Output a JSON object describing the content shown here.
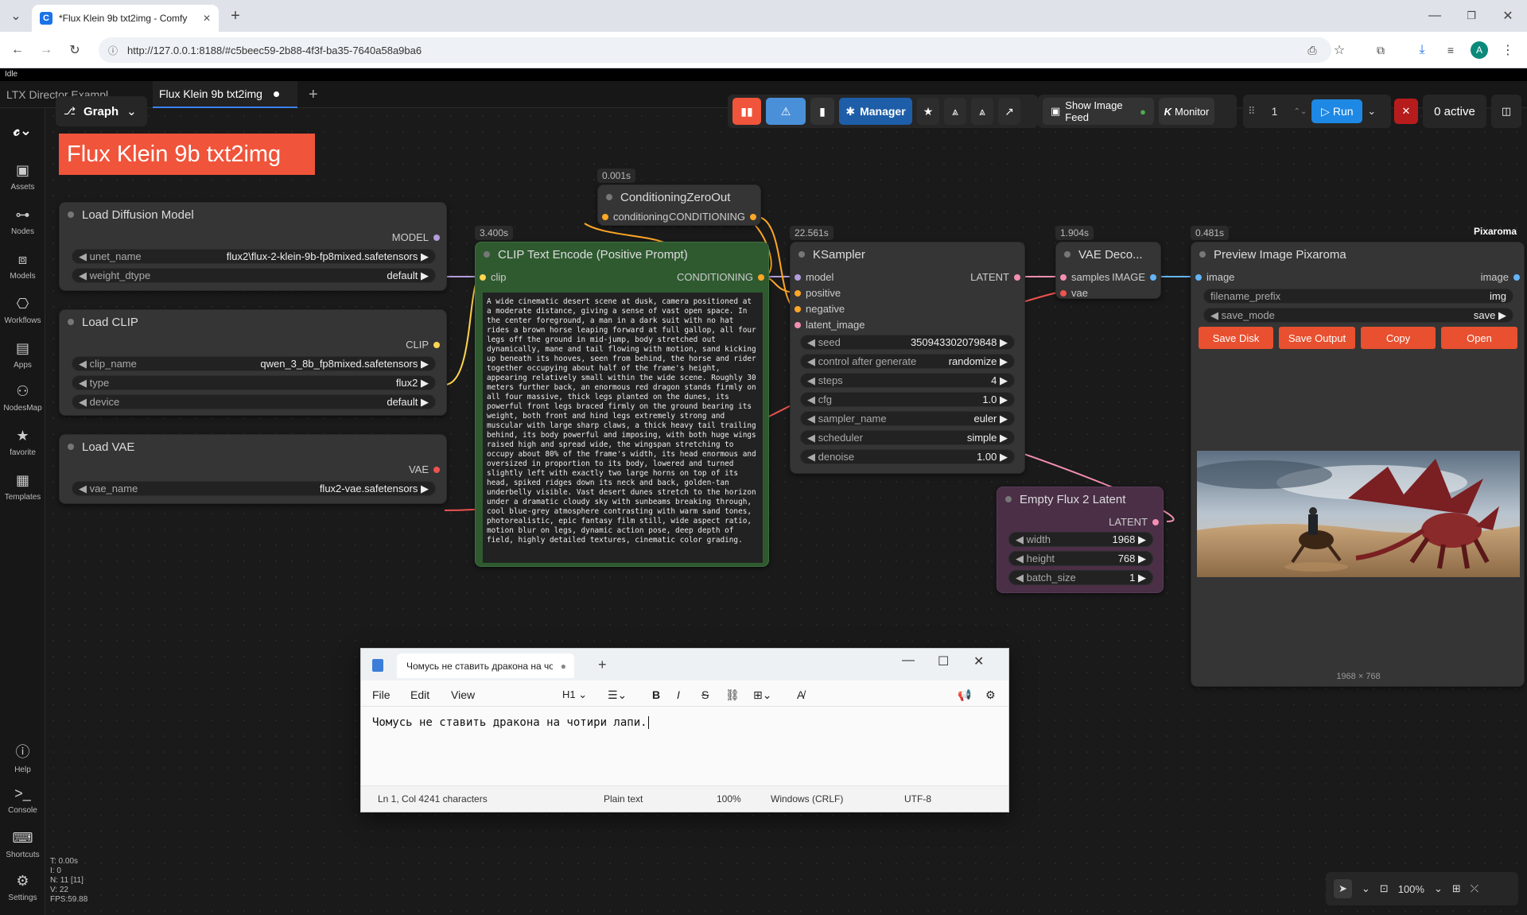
{
  "browser": {
    "tab_title": "*Flux Klein 9b txt2img - Comfy",
    "url": "http://127.0.0.1:8188/#c5beec59-2b88-4f3f-ba35-7640a58a9ba6",
    "profile_letter": "A"
  },
  "app": {
    "status": "Idle",
    "workspace_tabs": [
      "LTX Director Exampl...",
      "Flux Klein 9b txt2img"
    ],
    "graph_button": "Graph",
    "group_title": "Flux Klein 9b txt2img"
  },
  "sidebar": {
    "items": [
      "Assets",
      "Nodes",
      "Models",
      "Workflows",
      "Apps",
      "NodesMap",
      "favorite",
      "Templates"
    ],
    "bottom_items": [
      "Help",
      "Console",
      "Shortcuts",
      "Settings"
    ]
  },
  "toolbar": {
    "manager": "Manager",
    "show_image_feed": "Show Image Feed",
    "monitor": "Monitor",
    "batch_count": "1",
    "run": "Run",
    "active": "0 active"
  },
  "nodes": {
    "load_diffusion": {
      "title": "Load Diffusion Model",
      "output": "MODEL",
      "unet_name_label": "unet_name",
      "unet_name": "flux2\\flux-2-klein-9b-fp8mixed.safetensors",
      "weight_dtype_label": "weight_dtype",
      "weight_dtype": "default"
    },
    "load_clip": {
      "title": "Load CLIP",
      "output": "CLIP",
      "clip_name_label": "clip_name",
      "clip_name": "qwen_3_8b_fp8mixed.safetensors",
      "type_label": "type",
      "type": "flux2",
      "device_label": "device",
      "device": "default"
    },
    "load_vae": {
      "title": "Load VAE",
      "output": "VAE",
      "vae_name_label": "vae_name",
      "vae_name": "flux2-vae.safetensors"
    },
    "clip_encode": {
      "timing": "3.400s",
      "title": "CLIP Text Encode (Positive Prompt)",
      "input": "clip",
      "output": "CONDITIONING",
      "prompt": "A wide cinematic desert scene at dusk, camera positioned at a moderate distance, giving a sense of vast open space. In the center foreground, a man in a dark suit with no hat rides a brown horse leaping forward at full gallop, all four legs off the ground in mid-jump, body stretched out dynamically, mane and tail flowing with motion, sand kicking up beneath its hooves, seen from behind, the horse and rider together occupying about half of the frame's height, appearing relatively small within the wide scene. Roughly 30 meters further back, an enormous red dragon stands firmly on all four massive, thick legs planted on the dunes, its powerful front legs braced firmly on the ground bearing its weight, both front and hind legs extremely strong and muscular with large sharp claws, a thick heavy tail trailing behind, its body powerful and imposing, with both huge wings raised high and spread wide, the wingspan stretching to occupy about 80% of the frame's width, its head enormous and oversized in proportion to its body, lowered and turned slightly left with exactly two large horns on top of its head, spiked ridges down its neck and back, golden-tan underbelly visible. Vast desert dunes stretch to the horizon under a dramatic cloudy sky with sunbeams breaking through, cool blue-grey atmosphere contrasting with warm sand tones, photorealistic, epic fantasy film still, wide aspect ratio, motion blur on legs, dynamic action pose, deep depth of field, highly detailed textures, cinematic color grading."
    },
    "zero_out": {
      "timing": "0.001s",
      "title": "ConditioningZeroOut",
      "input": "conditioning",
      "output": "CONDITIONING"
    },
    "ksampler": {
      "timing": "22.561s",
      "title": "KSampler",
      "inputs": [
        "model",
        "positive",
        "negative",
        "latent_image"
      ],
      "output": "LATENT",
      "widgets": [
        {
          "label": "seed",
          "value": "350943302079848"
        },
        {
          "label": "control after generate",
          "value": "randomize"
        },
        {
          "label": "steps",
          "value": "4"
        },
        {
          "label": "cfg",
          "value": "1.0"
        },
        {
          "label": "sampler_name",
          "value": "euler"
        },
        {
          "label": "scheduler",
          "value": "simple"
        },
        {
          "label": "denoise",
          "value": "1.00"
        }
      ]
    },
    "vae_decode": {
      "timing": "1.904s",
      "title": "VAE Deco...",
      "inputs": [
        "samples",
        "vae"
      ],
      "output": "IMAGE"
    },
    "preview": {
      "timing": "0.481s",
      "badge": "Pixaroma",
      "title": "Preview Image Pixaroma",
      "input": "image",
      "output": "image",
      "filename_prefix_label": "filename_prefix",
      "filename_prefix": "img",
      "save_mode_label": "save_mode",
      "save_mode": "save",
      "buttons": [
        "Save Disk",
        "Save Output",
        "Copy",
        "Open"
      ],
      "image_size": "1968 × 768"
    },
    "empty_latent": {
      "title": "Empty Flux 2 Latent",
      "output": "LATENT",
      "widgets": [
        {
          "label": "width",
          "value": "1968"
        },
        {
          "label": "height",
          "value": "768"
        },
        {
          "label": "batch_size",
          "value": "1"
        }
      ]
    }
  },
  "stats": {
    "t": "T: 0.00s",
    "i": "I: 0",
    "n": "N: 11 [11]",
    "v": "V: 22",
    "fps": "FPS:59.88"
  },
  "zoom": "100%",
  "notepad": {
    "tab_title": "Чомусь не ставить дракона на чо",
    "menu": [
      "File",
      "Edit",
      "View"
    ],
    "heading_btn": "H1",
    "content": "Чомусь не ставить дракона на чотири лапи.",
    "status": {
      "position": "Ln 1, Col 42",
      "chars": "41 characters",
      "format": "Plain text",
      "zoom": "100%",
      "eol": "Windows (CRLF)",
      "encoding": "UTF-8"
    }
  }
}
